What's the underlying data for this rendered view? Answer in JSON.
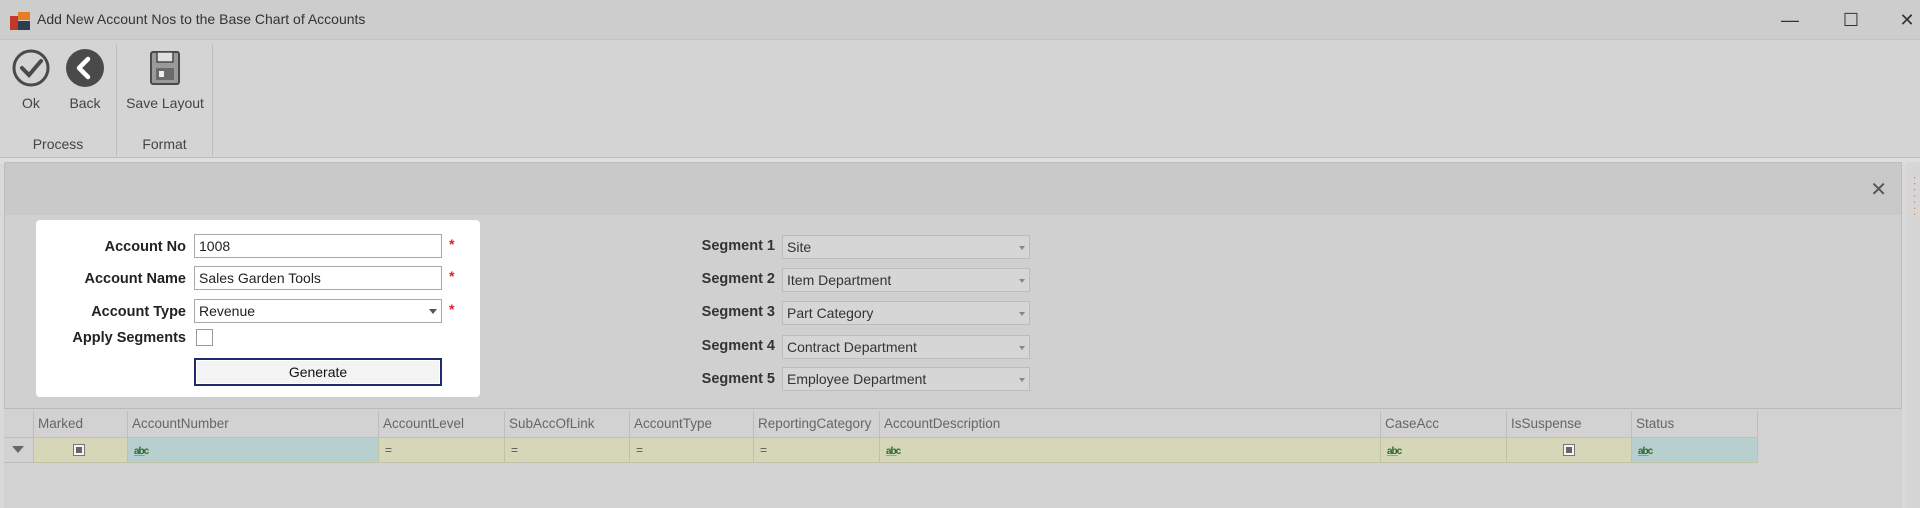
{
  "window": {
    "title": "Add New Account Nos to the Base Chart of Accounts",
    "controls": {
      "minimize": "—",
      "maximize": "☐",
      "close": "✕"
    }
  },
  "ribbon": {
    "groups": [
      {
        "label": "Process",
        "buttons": [
          {
            "label": "Ok",
            "icon": "check-circle-icon"
          },
          {
            "label": "Back",
            "icon": "back-arrow-icon"
          }
        ]
      },
      {
        "label": "Format",
        "buttons": [
          {
            "label": "Save Layout",
            "icon": "save-layout-icon"
          }
        ]
      }
    ]
  },
  "panel": {
    "close": "✕"
  },
  "form": {
    "account_no": {
      "label": "Account No",
      "value": "1008",
      "required": "*"
    },
    "account_name": {
      "label": "Account Name",
      "value": "Sales Garden Tools",
      "required": "*"
    },
    "account_type": {
      "label": "Account Type",
      "value": "Revenue",
      "required": "*"
    },
    "apply_segments": {
      "label": "Apply Segments",
      "checked": false
    },
    "generate_label": "Generate"
  },
  "segments": [
    {
      "label": "Segment 1",
      "value": "Site"
    },
    {
      "label": "Segment 2",
      "value": "Item Department"
    },
    {
      "label": "Segment 3",
      "value": "Part Category"
    },
    {
      "label": "Segment 4",
      "value": "Contract Department"
    },
    {
      "label": "Segment 5",
      "value": "Employee Department"
    }
  ],
  "grid": {
    "columns": [
      "Marked",
      "AccountNumber",
      "AccountLevel",
      "SubAccOfLink",
      "AccountType",
      "ReportingCategory",
      "AccountDescription",
      "CaseAcc",
      "IsSuspense",
      "Status"
    ],
    "filter_glyphs": {
      "text": "a̲b̲c",
      "equals": "="
    }
  },
  "colors": {
    "required": "#e02020",
    "generate_border": "#1f2b6e",
    "filter_text_cell": "#b7cfcf",
    "filter_cell": "#d6d6b9"
  }
}
